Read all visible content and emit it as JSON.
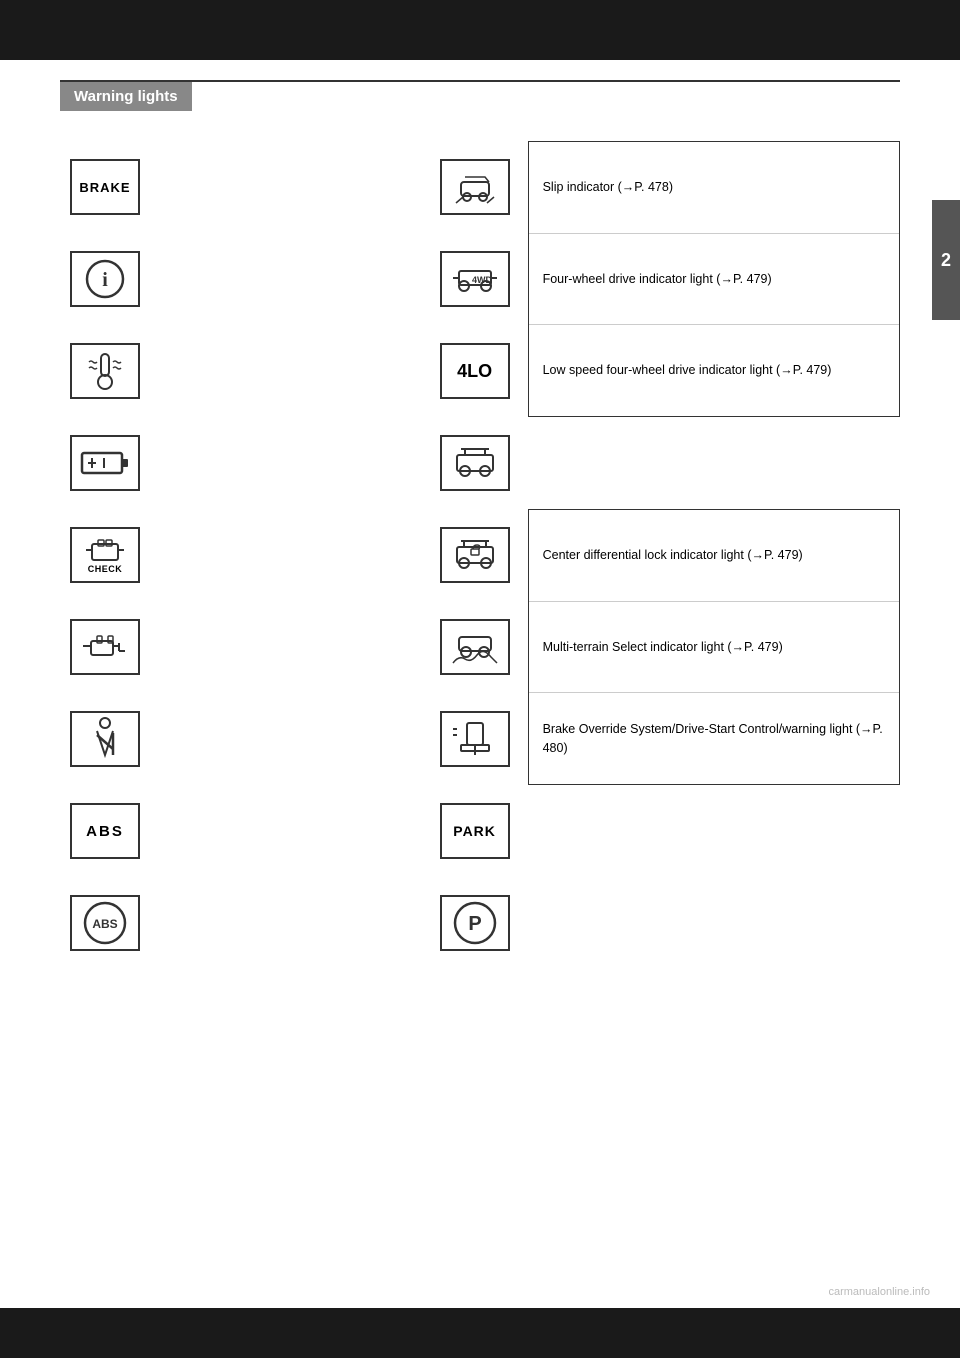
{
  "page": {
    "top_bar_color": "#1a1a1a",
    "chapter_number": "2",
    "header_rule_color": "#333",
    "section_title": "Warning lights",
    "section_header_bg": "#888",
    "watermark": "carmanualonline.info"
  },
  "left_icons": [
    {
      "id": "brake",
      "type": "text_box",
      "text": "BRAKE"
    },
    {
      "id": "circle_i",
      "type": "circle_i",
      "text": "Ⓘ"
    },
    {
      "id": "coolant",
      "type": "svg_coolant",
      "text": ""
    },
    {
      "id": "battery",
      "type": "svg_battery",
      "text": ""
    },
    {
      "id": "check",
      "type": "svg_check_engine",
      "text": "CHECK"
    },
    {
      "id": "engine",
      "type": "svg_engine",
      "text": ""
    },
    {
      "id": "seatbelt",
      "type": "svg_seatbelt",
      "text": ""
    },
    {
      "id": "abs_text",
      "type": "text_box",
      "text": "ABS"
    },
    {
      "id": "abs_circle",
      "type": "circle_text",
      "text": "ABS"
    }
  ],
  "right_icons": [
    {
      "id": "slip",
      "type": "svg_slip",
      "callout": "Slip indicator (→P. 478)"
    },
    {
      "id": "4wd",
      "type": "svg_4wd",
      "callout": "Four-wheel drive indicator light (→P. 479)"
    },
    {
      "id": "4lo",
      "type": "text_box",
      "text": "4LO",
      "callout": "Low speed four-wheel drive indicator light (→P. 479)"
    },
    {
      "id": "terrain1",
      "type": "svg_terrain1",
      "callout": null
    },
    {
      "id": "diff_lock",
      "type": "svg_diff_lock",
      "callout": "Center differential lock indicator light (→P. 479)"
    },
    {
      "id": "multi_terrain",
      "type": "svg_multi_terrain",
      "callout": "Multi-terrain Select indicator light (→P. 479)"
    },
    {
      "id": "brake_override",
      "type": "svg_brake_override",
      "callout": "Brake Override System/Drive-Start Control/warning light (→P. 480)"
    },
    {
      "id": "park_text",
      "type": "text_box",
      "text": "PARK",
      "callout": null
    },
    {
      "id": "park_circle",
      "type": "circle_p",
      "text": "P",
      "callout": null
    }
  ],
  "callout_group_1": {
    "items": [
      "Slip indicator (→P. 478)",
      "Four-wheel drive indicator light (→P. 479)",
      "Low speed four-wheel drive indicator light (→P. 479)"
    ]
  },
  "callout_group_2": {
    "items": [
      "Center differential lock indicator light (→P. 479)",
      "Multi-terrain Select indicator light (→P. 479)",
      "Brake Override System/Drive-Start Control/warning light (→P. 480)"
    ]
  }
}
